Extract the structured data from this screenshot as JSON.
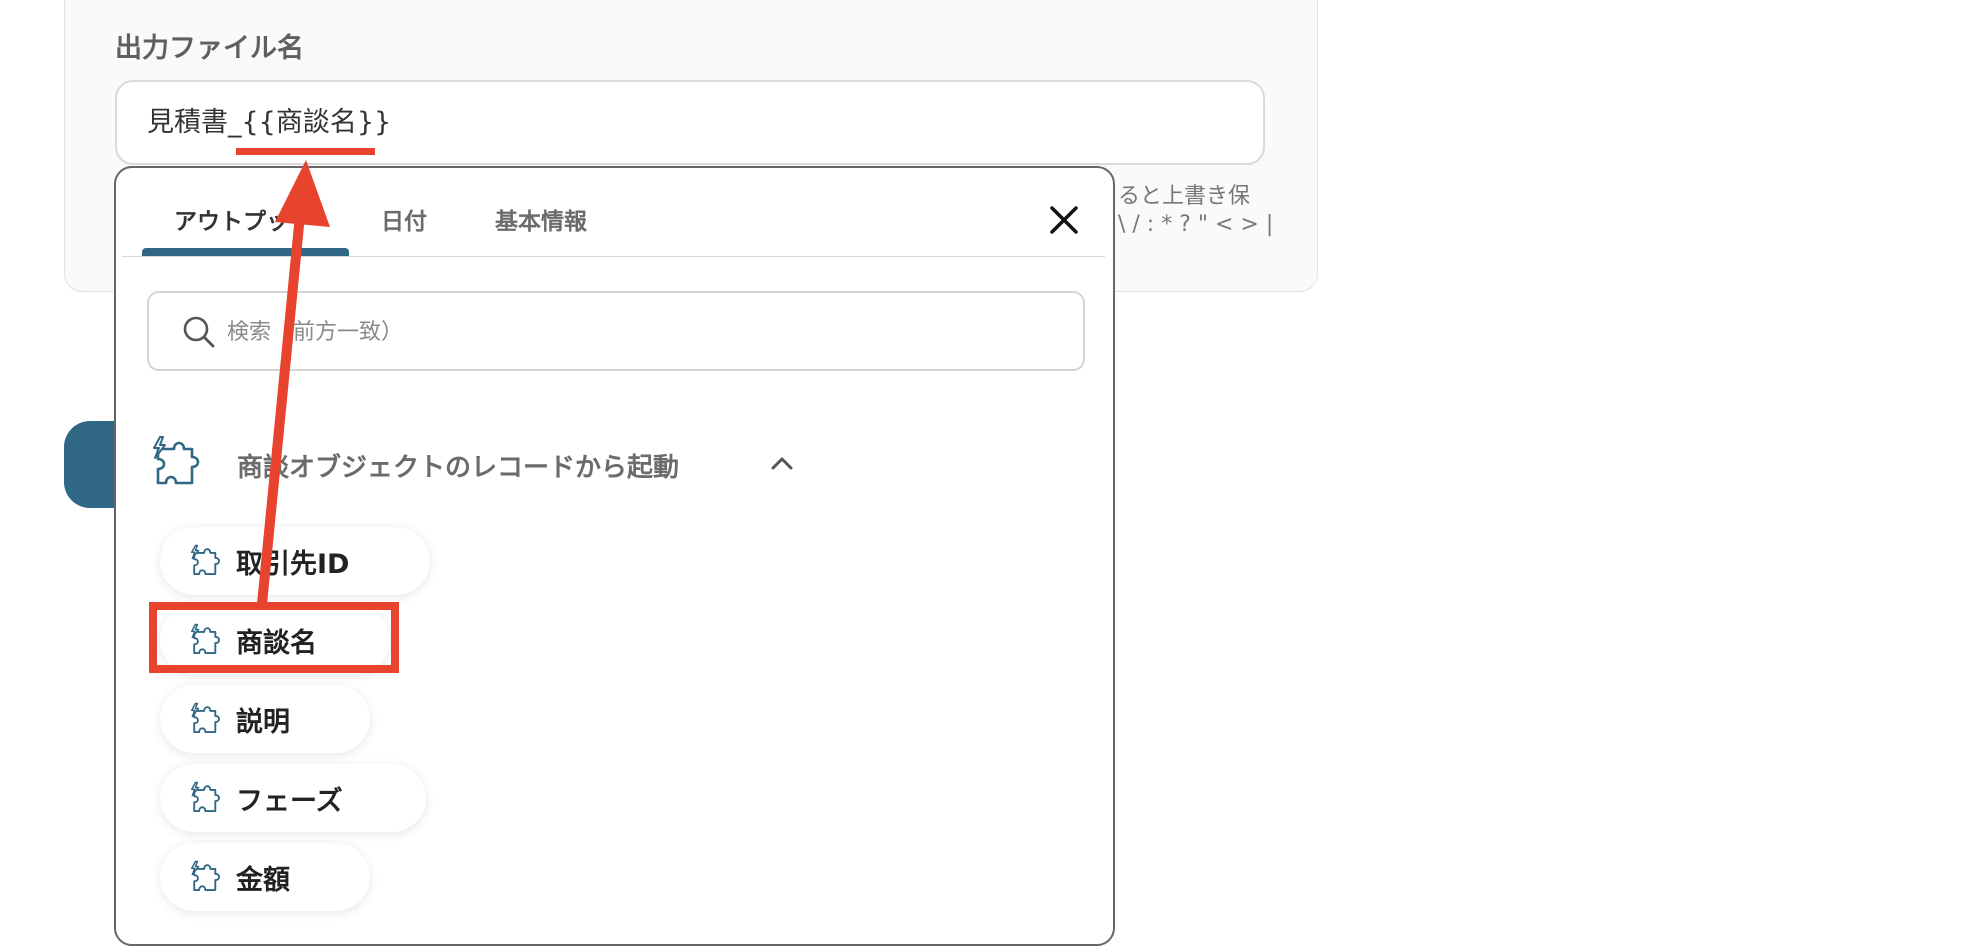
{
  "form": {
    "field_label": "出力ファイル名",
    "filename_value": "見積書_{{商談名}}",
    "hint_line1": "ると上書き保",
    "hint_line2": "\\ / : * ? \" < > |"
  },
  "dropdown": {
    "tabs": [
      {
        "label": "アウトプット",
        "active": true
      },
      {
        "label": "日付",
        "active": false
      },
      {
        "label": "基本情報",
        "active": false
      }
    ],
    "search_placeholder": "検索（前方一致）",
    "section_title": "商談オブジェクトのレコードから起動",
    "items": [
      {
        "label": "取引先ID"
      },
      {
        "label": "商談名",
        "highlighted": true
      },
      {
        "label": "説明"
      },
      {
        "label": "フェーズ"
      },
      {
        "label": "金額"
      }
    ]
  },
  "icons": {
    "close": "close-icon",
    "search": "search-icon",
    "section": "puzzle-lightning-icon",
    "chevron": "chevron-up-icon",
    "item": "puzzle-lightning-icon"
  },
  "colors": {
    "accent": "#2f6785",
    "annotation": "#e8432c"
  }
}
